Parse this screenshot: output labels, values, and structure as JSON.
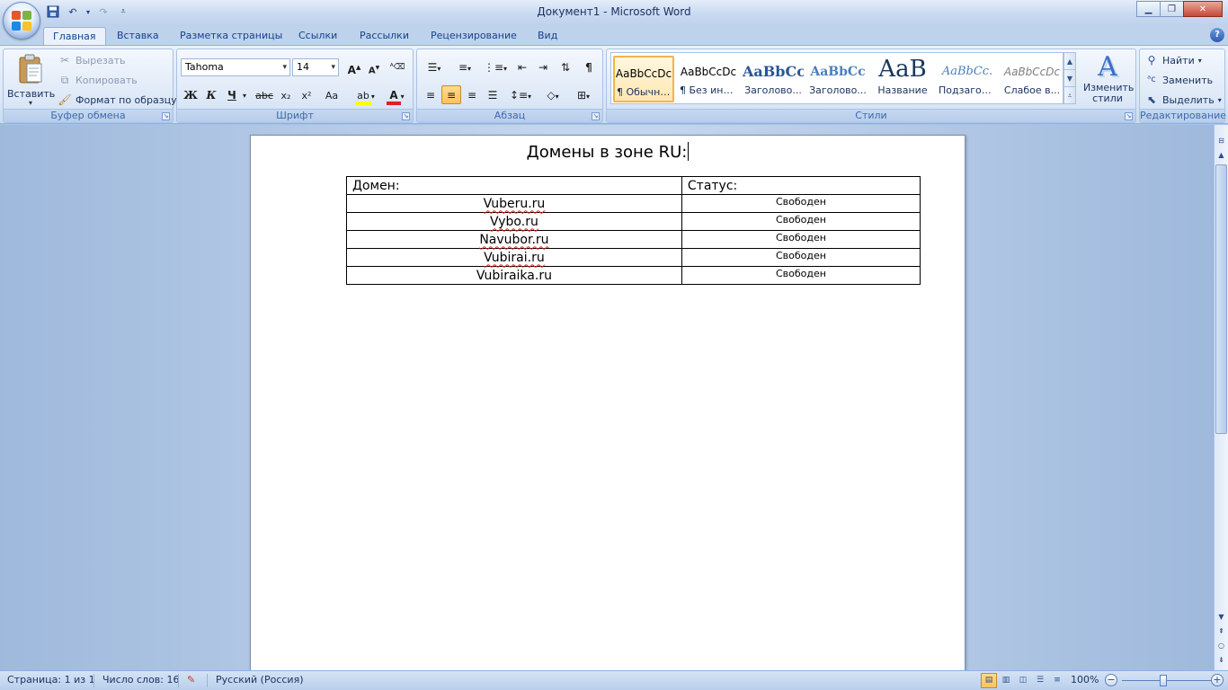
{
  "window": {
    "title": "Документ1 - Microsoft Word"
  },
  "tabs": [
    {
      "label": "Главная"
    },
    {
      "label": "Вставка"
    },
    {
      "label": "Разметка страницы"
    },
    {
      "label": "Ссылки"
    },
    {
      "label": "Рассылки"
    },
    {
      "label": "Рецензирование"
    },
    {
      "label": "Вид"
    }
  ],
  "clipboard": {
    "group_label": "Буфер обмена",
    "paste": "Вставить",
    "cut": "Вырезать",
    "copy": "Копировать",
    "format_painter": "Формат по образцу"
  },
  "font": {
    "group_label": "Шрифт",
    "family": "Tahoma",
    "size": "14",
    "bold": "Ж",
    "italic": "К",
    "underline": "Ч",
    "strike": "abc",
    "subscript": "x₂",
    "superscript": "x²",
    "case": "Aa"
  },
  "paragraph": {
    "group_label": "Абзац",
    "alignment": "center"
  },
  "styles": {
    "group_label": "Стили",
    "change_styles": "Изменить стили",
    "items": [
      {
        "sample": "AaBbCcDc",
        "name": "¶ Обычный"
      },
      {
        "sample": "AaBbCcDc",
        "name": "¶ Без инте..."
      },
      {
        "sample": "AaBbCc",
        "name": "Заголово..."
      },
      {
        "sample": "AaBbCc",
        "name": "Заголово..."
      },
      {
        "sample": "AaB",
        "name": "Название"
      },
      {
        "sample": "AaBbCc.",
        "name": "Подзагол..."
      },
      {
        "sample": "AaBbCcDc",
        "name": "Слабое в..."
      }
    ]
  },
  "editing": {
    "group_label": "Редактирование",
    "find": "Найти",
    "replace": "Заменить",
    "select": "Выделить"
  },
  "document": {
    "title": "Домены в зоне RU:",
    "table": {
      "headers": [
        "Домен:",
        "Статус:"
      ],
      "rows": [
        [
          "Vuberu.ru",
          "Свободен"
        ],
        [
          "Vybo.ru",
          "Свободен"
        ],
        [
          "Navubor.ru",
          "Свободен"
        ],
        [
          "Vubirai.ru",
          "Свободен"
        ],
        [
          "Vubiraika.ru",
          "Свободен"
        ]
      ]
    }
  },
  "statusbar": {
    "page": "Страница: 1 из 1",
    "words": "Число слов: 16",
    "language": "Русский (Россия)",
    "zoom": "100%"
  },
  "colors": {
    "accent": "#15428b",
    "ribbon": "#dbe7f6",
    "selected_style": "#f5b34a"
  }
}
